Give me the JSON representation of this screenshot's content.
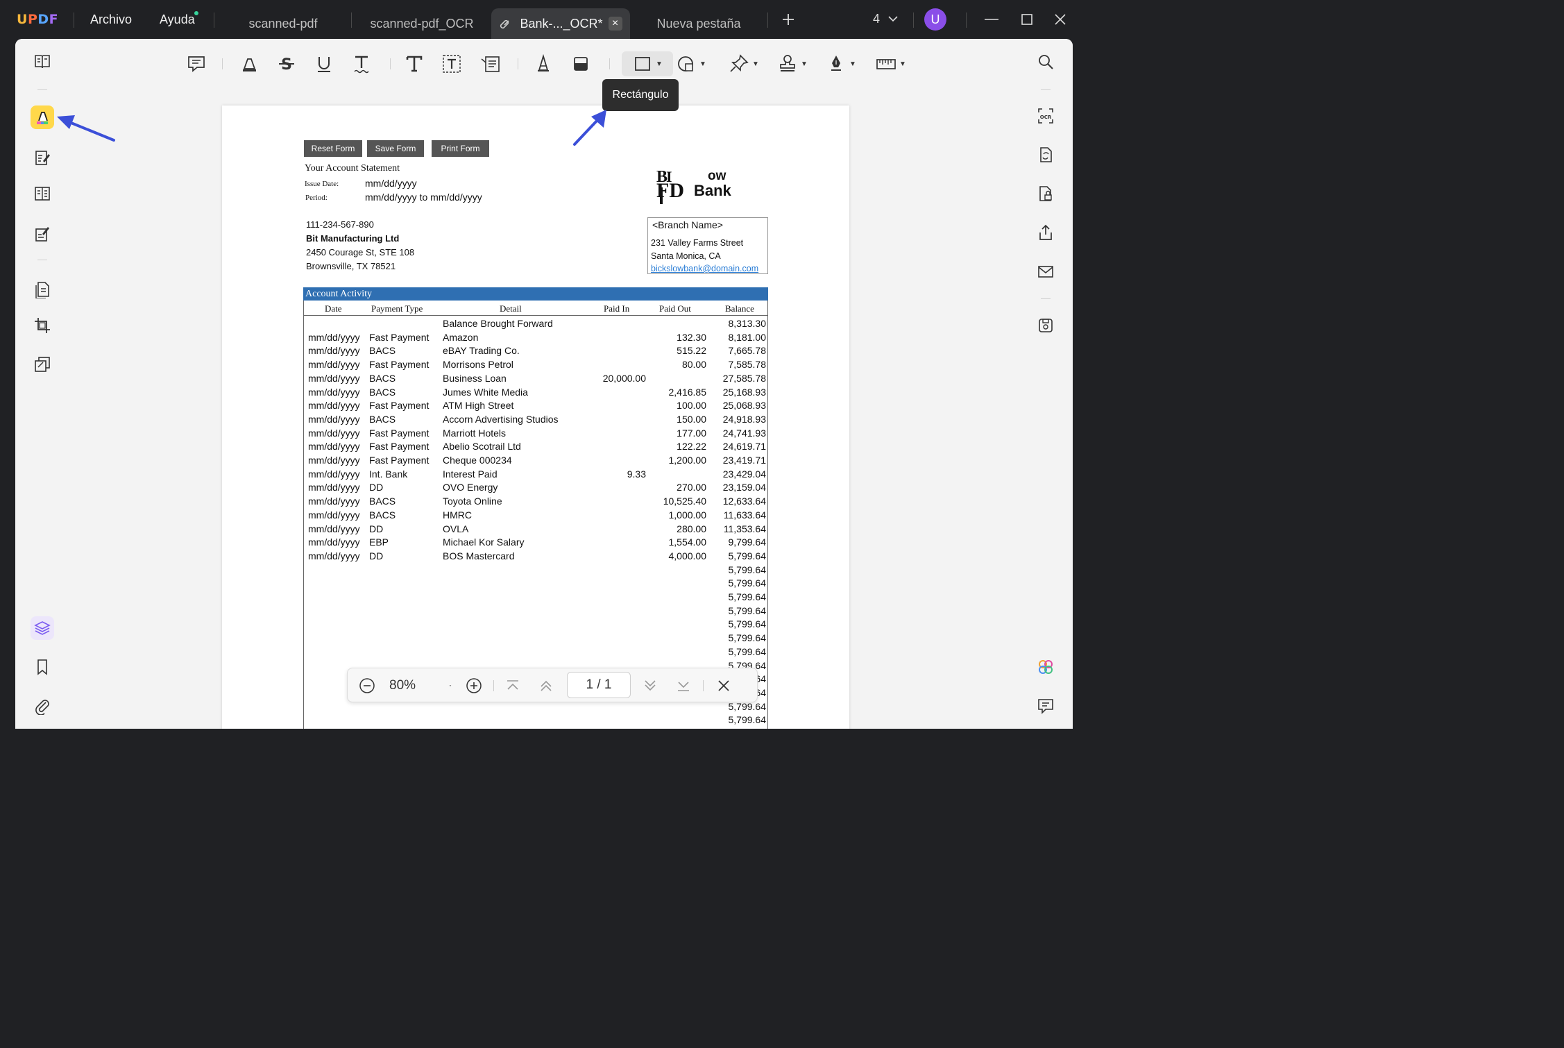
{
  "app": {
    "logo": "UPDF"
  },
  "menu": {
    "file": "Archivo",
    "help": "Ayuda"
  },
  "tabs": [
    {
      "label": "scanned-pdf"
    },
    {
      "label": "scanned-pdf_OCR"
    },
    {
      "label": "Bank-..._OCR*"
    },
    {
      "label": "Nueva pestaña"
    }
  ],
  "titlebar": {
    "page_count": "4",
    "avatar": "U"
  },
  "tooltip": {
    "text": "Rectángulo"
  },
  "colors": {
    "accent": "#8a4ee8",
    "active_tool": "#ffd84a",
    "activity_bar": "#2f6fb2",
    "arrow": "#3b4fd8"
  },
  "document": {
    "buttons": {
      "reset": "Reset Form",
      "save": "Save Form",
      "print": "Print Form"
    },
    "statement_title": "Your Account Statement",
    "issue_label": "Issue Date:",
    "issue_value": "mm/dd/yyyy",
    "period_label": "Period:",
    "period_value": "mm/dd/yyyy to mm/dd/yyyy",
    "bank_logo_letters": "BI FD",
    "bank_name_line1": "ow",
    "bank_name_line2": "Bank",
    "account": {
      "number": "111-234-567-890",
      "company": "Bit Manufacturing Ltd",
      "address1": "2450 Courage St, STE 108",
      "address2": "Brownsville, TX 78521"
    },
    "branch": {
      "name": "<Branch Name>",
      "street": "231 Valley Farms Street",
      "city": "Santa Monica, CA",
      "email": "bickslowbank@domain.com"
    },
    "activity_title": "Account Activity",
    "columns": [
      "Date",
      "Payment Type",
      "Detail",
      "Paid In",
      "Paid Out",
      "Balance"
    ],
    "rows": [
      {
        "date": "",
        "type": "",
        "detail": "Balance Brought Forward",
        "paid_in": "",
        "paid_out": "",
        "balance": "8,313.30"
      },
      {
        "date": "mm/dd/yyyy",
        "type": "Fast Payment",
        "detail": "Amazon",
        "paid_in": "",
        "paid_out": "132.30",
        "balance": "8,181.00"
      },
      {
        "date": "mm/dd/yyyy",
        "type": "BACS",
        "detail": "eBAY Trading Co.",
        "paid_in": "",
        "paid_out": "515.22",
        "balance": "7,665.78"
      },
      {
        "date": "mm/dd/yyyy",
        "type": "Fast Payment",
        "detail": "Morrisons Petrol",
        "paid_in": "",
        "paid_out": "80.00",
        "balance": "7,585.78"
      },
      {
        "date": "mm/dd/yyyy",
        "type": "BACS",
        "detail": "Business Loan",
        "paid_in": "20,000.00",
        "paid_out": "",
        "balance": "27,585.78"
      },
      {
        "date": "mm/dd/yyyy",
        "type": "BACS",
        "detail": "Jumes White Media",
        "paid_in": "",
        "paid_out": "2,416.85",
        "balance": "25,168.93"
      },
      {
        "date": "mm/dd/yyyy",
        "type": "Fast Payment",
        "detail": "ATM High Street",
        "paid_in": "",
        "paid_out": "100.00",
        "balance": "25,068.93"
      },
      {
        "date": "mm/dd/yyyy",
        "type": "BACS",
        "detail": "Accorn Advertising Studios",
        "paid_in": "",
        "paid_out": "150.00",
        "balance": "24,918.93"
      },
      {
        "date": "mm/dd/yyyy",
        "type": "Fast Payment",
        "detail": "Marriott Hotels",
        "paid_in": "",
        "paid_out": "177.00",
        "balance": "24,741.93"
      },
      {
        "date": "mm/dd/yyyy",
        "type": "Fast Payment",
        "detail": "Abelio Scotrail Ltd",
        "paid_in": "",
        "paid_out": "122.22",
        "balance": "24,619.71"
      },
      {
        "date": "mm/dd/yyyy",
        "type": "Fast Payment",
        "detail": "Cheque 000234",
        "paid_in": "",
        "paid_out": "1,200.00",
        "balance": "23,419.71"
      },
      {
        "date": "mm/dd/yyyy",
        "type": "Int. Bank",
        "detail": "Interest Paid",
        "paid_in": "9.33",
        "paid_out": "",
        "balance": "23,429.04"
      },
      {
        "date": "mm/dd/yyyy",
        "type": "DD",
        "detail": "OVO Energy",
        "paid_in": "",
        "paid_out": "270.00",
        "balance": "23,159.04"
      },
      {
        "date": "mm/dd/yyyy",
        "type": "BACS",
        "detail": "Toyota Online",
        "paid_in": "",
        "paid_out": "10,525.40",
        "balance": "12,633.64"
      },
      {
        "date": "mm/dd/yyyy",
        "type": "BACS",
        "detail": "HMRC",
        "paid_in": "",
        "paid_out": "1,000.00",
        "balance": "11,633.64"
      },
      {
        "date": "mm/dd/yyyy",
        "type": "DD",
        "detail": "OVLA",
        "paid_in": "",
        "paid_out": "280.00",
        "balance": "11,353.64"
      },
      {
        "date": "mm/dd/yyyy",
        "type": "EBP",
        "detail": "Michael Kor Salary",
        "paid_in": "",
        "paid_out": "1,554.00",
        "balance": "9,799.64"
      },
      {
        "date": "mm/dd/yyyy",
        "type": "DD",
        "detail": "BOS Mastercard",
        "paid_in": "",
        "paid_out": "4,000.00",
        "balance": "5,799.64"
      },
      {
        "date": "",
        "type": "",
        "detail": "",
        "paid_in": "",
        "paid_out": "",
        "balance": "5,799.64"
      },
      {
        "date": "",
        "type": "",
        "detail": "",
        "paid_in": "",
        "paid_out": "",
        "balance": "5,799.64"
      },
      {
        "date": "",
        "type": "",
        "detail": "",
        "paid_in": "",
        "paid_out": "",
        "balance": "5,799.64"
      },
      {
        "date": "",
        "type": "",
        "detail": "",
        "paid_in": "",
        "paid_out": "",
        "balance": "5,799.64"
      },
      {
        "date": "",
        "type": "",
        "detail": "",
        "paid_in": "",
        "paid_out": "",
        "balance": "5,799.64"
      },
      {
        "date": "",
        "type": "",
        "detail": "",
        "paid_in": "",
        "paid_out": "",
        "balance": "5,799.64"
      },
      {
        "date": "",
        "type": "",
        "detail": "",
        "paid_in": "",
        "paid_out": "",
        "balance": "5,799.64"
      },
      {
        "date": "",
        "type": "",
        "detail": "",
        "paid_in": "",
        "paid_out": "",
        "balance": "5,799.64"
      },
      {
        "date": "",
        "type": "",
        "detail": "",
        "paid_in": "",
        "paid_out": "",
        "balance": "5,799.64"
      },
      {
        "date": "",
        "type": "",
        "detail": "",
        "paid_in": "",
        "paid_out": "",
        "balance": "5,799.64"
      },
      {
        "date": "",
        "type": "",
        "detail": "",
        "paid_in": "",
        "paid_out": "",
        "balance": "5,799.64"
      },
      {
        "date": "",
        "type": "",
        "detail": "",
        "paid_in": "",
        "paid_out": "",
        "balance": "5,799.64"
      }
    ]
  },
  "zoombar": {
    "zoom": "80%",
    "page_indicator": "1 / 1"
  },
  "icons": {
    "left_rail": [
      "reader-icon",
      "comment-highlight-icon",
      "edit-pdf-icon",
      "organize-pages-icon",
      "fill-sign-icon",
      "page-tools-icon",
      "crop-icon",
      "compare-icon",
      "layers-icon",
      "bookmark-icon",
      "attachment-icon"
    ],
    "right_rail": [
      "search-icon",
      "ocr-icon",
      "convert-icon",
      "protect-icon",
      "share-icon",
      "email-icon",
      "save-icon",
      "ai-assistant-icon",
      "comments-panel-icon"
    ]
  }
}
